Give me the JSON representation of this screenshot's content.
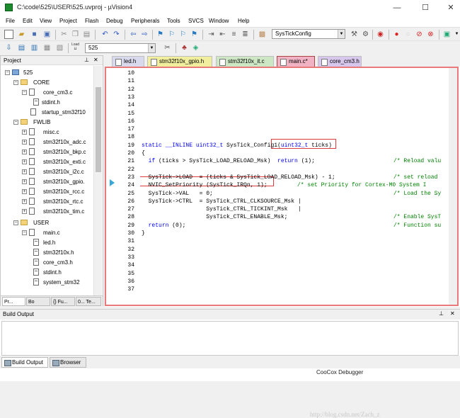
{
  "window": {
    "title": "C:\\code\\525\\USER\\525.uvproj - µVision4",
    "minimize": "—",
    "maximize": "☐",
    "close": "✕"
  },
  "menu": [
    "File",
    "Edit",
    "View",
    "Project",
    "Flash",
    "Debug",
    "Peripherals",
    "Tools",
    "SVCS",
    "Window",
    "Help"
  ],
  "toolbar": {
    "function_combo": "SysTickConfig",
    "target_combo": "525",
    "load_label": "Load"
  },
  "project_panel": {
    "title": "Project",
    "tree": [
      {
        "label": "525",
        "type": "root",
        "expanded": true
      },
      {
        "label": "CORE",
        "type": "folder",
        "expanded": true
      },
      {
        "label": "core_cm3.c",
        "type": "file",
        "expanded": true
      },
      {
        "label": "stdint.h",
        "type": "hfile"
      },
      {
        "label": "startup_stm32f10",
        "type": "file"
      },
      {
        "label": "FWLIB",
        "type": "folder",
        "expanded": true
      },
      {
        "label": "misc.c",
        "type": "file"
      },
      {
        "label": "stm32f10x_adc.c",
        "type": "file"
      },
      {
        "label": "stm32f10x_bkp.c",
        "type": "file"
      },
      {
        "label": "stm32f10x_exti.c",
        "type": "file"
      },
      {
        "label": "stm32f10x_i2c.c",
        "type": "file"
      },
      {
        "label": "stm32f10x_gpio.",
        "type": "file"
      },
      {
        "label": "stm32f10x_rcc.c",
        "type": "file"
      },
      {
        "label": "stm32f10x_rtc.c",
        "type": "file"
      },
      {
        "label": "stm32f10x_tim.c",
        "type": "file"
      },
      {
        "label": "USER",
        "type": "folder",
        "expanded": true
      },
      {
        "label": "main.c",
        "type": "file",
        "expanded": true
      },
      {
        "label": "led.h",
        "type": "hfile"
      },
      {
        "label": "stm32f10x.h",
        "type": "hfile"
      },
      {
        "label": "core_cm3.h",
        "type": "hfile"
      },
      {
        "label": "stdint.h",
        "type": "hfile"
      },
      {
        "label": "system_stm32",
        "type": "hfile"
      }
    ],
    "tabs": [
      "Pr...",
      "Bo",
      "{} Fu...",
      "0... Te..."
    ]
  },
  "editor": {
    "tabs": [
      {
        "label": "led.h"
      },
      {
        "label": "stm32f10x_gpio.h"
      },
      {
        "label": "stm32f10x_it.c"
      },
      {
        "label": "main.c*"
      },
      {
        "label": "core_cm3.h"
      }
    ],
    "lines": [
      {
        "n": "10",
        "code": ""
      },
      {
        "n": "11",
        "code": ""
      },
      {
        "n": "12",
        "code": ""
      },
      {
        "n": "13",
        "code": ""
      },
      {
        "n": "14",
        "code": ""
      },
      {
        "n": "15",
        "code": ""
      },
      {
        "n": "16",
        "code": ""
      },
      {
        "n": "17",
        "code": ""
      },
      {
        "n": "18",
        "code": ""
      },
      {
        "n": "19",
        "code": "static __INLINE uint32_t SysTick_Config1(uint32_t ticks)"
      },
      {
        "n": "20",
        "code": "{"
      },
      {
        "n": "21",
        "code": "  if (ticks > SysTick_LOAD_RELOAD_Msk)  return (1);",
        "comment": "/* Reload valu"
      },
      {
        "n": "22",
        "code": ""
      },
      {
        "n": "23",
        "code": "  SysTick->LOAD  = (ticks & SysTick_LOAD_RELOAD_Msk) - 1;",
        "comment": "/* set reload"
      },
      {
        "n": "24",
        "code": "  NVIC_SetPriority (SysTick_IRQn, 1);",
        "comment": "/* set Priority for Cortex-M0 System I"
      },
      {
        "n": "25",
        "code": "  SysTick->VAL   = 0;",
        "comment": "/* Load the Sy"
      },
      {
        "n": "26",
        "code": "  SysTick->CTRL  = SysTick_CTRL_CLKSOURCE_Msk |"
      },
      {
        "n": "27",
        "code": "                   SysTick_CTRL_TICKINT_Msk   |"
      },
      {
        "n": "28",
        "code": "                   SysTick_CTRL_ENABLE_Msk;",
        "comment": "/* Enable SysT"
      },
      {
        "n": "29",
        "code": "  return (0);",
        "comment": "/* Function su"
      },
      {
        "n": "30",
        "code": "}"
      },
      {
        "n": "31",
        "code": ""
      },
      {
        "n": "32",
        "code": ""
      },
      {
        "n": "33",
        "code": ""
      },
      {
        "n": "34",
        "code": ""
      },
      {
        "n": "35",
        "code": ""
      },
      {
        "n": "36",
        "code": ""
      },
      {
        "n": "37",
        "code": ""
      }
    ]
  },
  "build_output": {
    "title": "Build Output",
    "tabs": [
      "Build Output",
      "Browser"
    ],
    "debugger_label": "CooCox Debugger",
    "watermark": "http://blog.csdn.net/Zach_z"
  },
  "colors": {
    "keyword": "#0000ff",
    "comment": "#008000",
    "highlight_box": "#e03a3a",
    "editor_border": "#e87a7a"
  }
}
